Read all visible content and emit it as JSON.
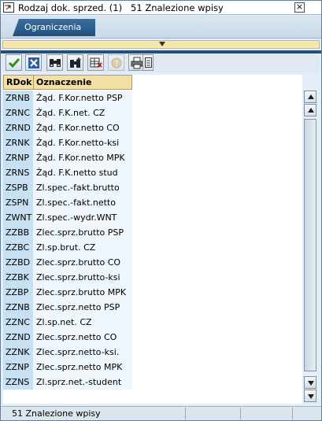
{
  "window": {
    "title": "Rodzaj dok. sprzed. (1)   51 Znalezione wpisy",
    "close_label": "×"
  },
  "tabs": [
    {
      "label": "Ograniczenia",
      "selected": true
    }
  ],
  "toolbar": {
    "buttons": [
      {
        "name": "confirm",
        "icon": "checkmark-icon"
      },
      {
        "name": "cancel",
        "icon": "x-icon"
      },
      {
        "name": "find",
        "icon": "binoculars-icon"
      },
      {
        "name": "find-next",
        "icon": "binoculars-plus-icon"
      },
      {
        "name": "sort",
        "icon": "table-sort-icon"
      },
      {
        "name": "help",
        "icon": "help-icon",
        "disabled": true
      },
      {
        "name": "print",
        "icon": "printer-icon"
      },
      {
        "name": "details",
        "icon": "details-icon"
      }
    ]
  },
  "table": {
    "columns": [
      "RDok",
      "Oznaczenie"
    ],
    "rows": [
      [
        "ZRNB",
        "Żąd. F.Kor.netto PSP"
      ],
      [
        "ZRNC",
        "Żąd. F.K.net. CZ"
      ],
      [
        "ZRND",
        "Żąd. F.Kor.netto CO"
      ],
      [
        "ZRNK",
        "Żąd. F.Kor.netto-ksi"
      ],
      [
        "ZRNP",
        "Żąd. F.Kor.netto MPK"
      ],
      [
        "ZRNS",
        "Żąd. F.K.netto stud"
      ],
      [
        "ZSPB",
        "Zl.spec.-fakt.brutto"
      ],
      [
        "ZSPN",
        "Zl.spec.-fakt.netto"
      ],
      [
        "ZWNT",
        "Zl.spec.-wydr.WNT"
      ],
      [
        "ZZBB",
        "Zlec.sprz.brutto PSP"
      ],
      [
        "ZZBC",
        "Zl.sp.brut. CZ"
      ],
      [
        "ZZBD",
        "Zlec.sprz.brutto CO"
      ],
      [
        "ZZBK",
        "Zlec.sprz.brutto-ksi"
      ],
      [
        "ZZBP",
        "Zlec.sprz.brutto MPK"
      ],
      [
        "ZZNB",
        "Zlec.sprz.netto PSP"
      ],
      [
        "ZZNC",
        "Zl.sp.net. CZ"
      ],
      [
        "ZZND",
        "Zlec.sprz.netto CO"
      ],
      [
        "ZZNK",
        "Zlec.sprz.netto-ksi."
      ],
      [
        "ZZNP",
        "Zlec.sprz.netto MPK"
      ],
      [
        "ZZNS",
        "Zl.sprz.net.-student"
      ]
    ]
  },
  "status": {
    "text": "51 Znalezione wpisy"
  },
  "colors": {
    "tab_active": "#2a5886",
    "header_bg": "#f3e0a6",
    "key_col_bg": "#c7e0f2",
    "text_col_bg": "#f0f7fc",
    "collapse_bar": "#f5e7ad"
  }
}
